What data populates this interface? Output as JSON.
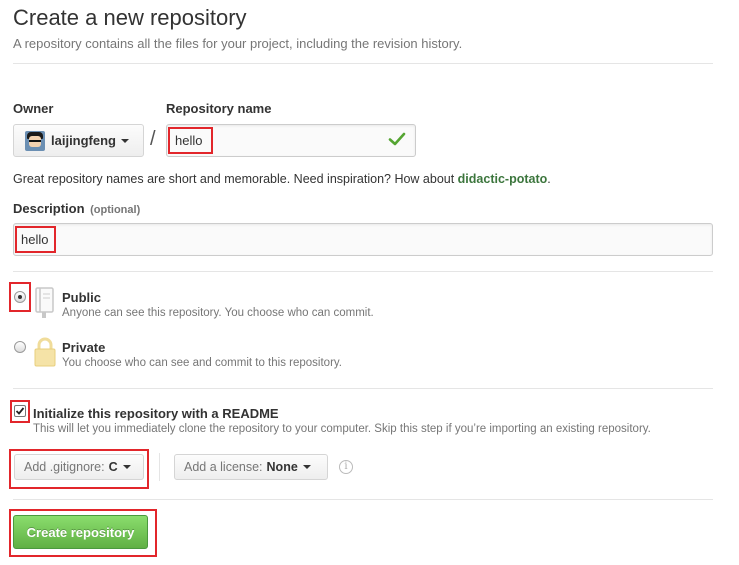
{
  "header": {
    "title": "Create a new repository",
    "subtitle": "A repository contains all the files for your project, including the revision history."
  },
  "owner": {
    "label": "Owner",
    "selected": "laijingfeng"
  },
  "repository_name": {
    "label": "Repository name",
    "value": "hello",
    "status": "valid"
  },
  "separator": "/",
  "hint": {
    "text": "Great repository names are short and memorable. Need inspiration? How about ",
    "suggestion": "didactic-potato",
    "suffix": "."
  },
  "description": {
    "label": "Description",
    "optional_label": "(optional)",
    "value": "hello"
  },
  "visibility": {
    "selected": "Public",
    "options": [
      {
        "title": "Public",
        "note": "Anyone can see this repository. You choose who can commit.",
        "icon": "book-icon",
        "checked": true
      },
      {
        "title": "Private",
        "note": "You choose who can see and commit to this repository.",
        "icon": "lock-icon",
        "checked": false
      }
    ]
  },
  "readme": {
    "checked": true,
    "title": "Initialize this repository with a README",
    "note": "This will let you immediately clone the repository to your computer. Skip this step if you’re importing an existing repository."
  },
  "gitignore": {
    "prefix": "Add .gitignore:",
    "value": "C"
  },
  "license": {
    "prefix": "Add a license:",
    "value": "None"
  },
  "info_icon": "info-icon",
  "submit": {
    "label": "Create repository"
  },
  "colors": {
    "highlight": "#e2262b",
    "primary_green": "#60b044",
    "suggestion_green": "#3c763d",
    "valid_check": "#55a532"
  }
}
